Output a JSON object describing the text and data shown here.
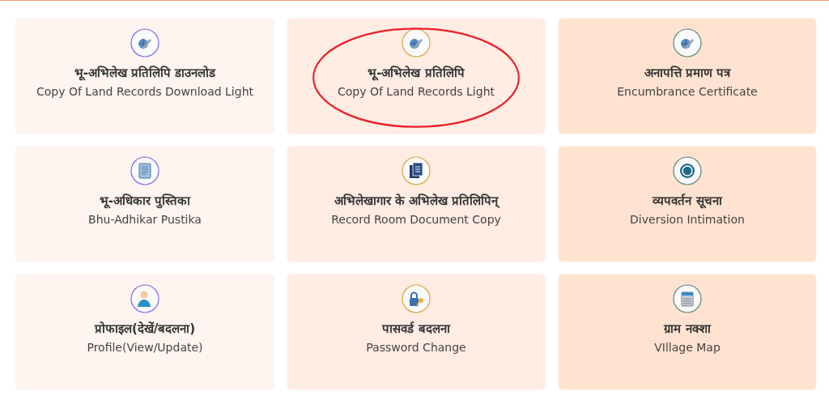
{
  "cards": [
    {
      "title": "भू-अभिलेख प्रतिलिपि डाउनलोड",
      "subtitle": "Copy Of Land Records Download Light",
      "kind": "globe-pencil",
      "circled": false
    },
    {
      "title": "भू-अभिलेख प्रतिलिपि",
      "subtitle": "Copy Of Land Records Light",
      "kind": "globe-pencil",
      "circled": true
    },
    {
      "title": "अनापत्ति प्रमाण पत्र",
      "subtitle": "Encumbrance Certificate",
      "kind": "globe-pencil",
      "circled": false
    },
    {
      "title": "भू-अधिकार पुस्तिका",
      "subtitle": "Bhu-Adhikar Pustika",
      "kind": "page",
      "circled": false
    },
    {
      "title": "अभिलेखागार के अभिलेख प्रतिलिपिन्",
      "subtitle": "Record Room Document Copy",
      "kind": "documents",
      "circled": false
    },
    {
      "title": "व्यपवर्तन सूचना",
      "subtitle": "Diversion Intimation",
      "kind": "badge",
      "circled": false
    },
    {
      "title": "प्रोफाइल(देखें/बदलना)",
      "subtitle": "Profile(View/Update)",
      "kind": "person",
      "circled": false
    },
    {
      "title": "पासवर्ड बदलना",
      "subtitle": "Password Change",
      "kind": "lock-key",
      "circled": false
    },
    {
      "title": "ग्राम नक्शा",
      "subtitle": "VIllage Map",
      "kind": "calendar",
      "circled": false
    }
  ]
}
